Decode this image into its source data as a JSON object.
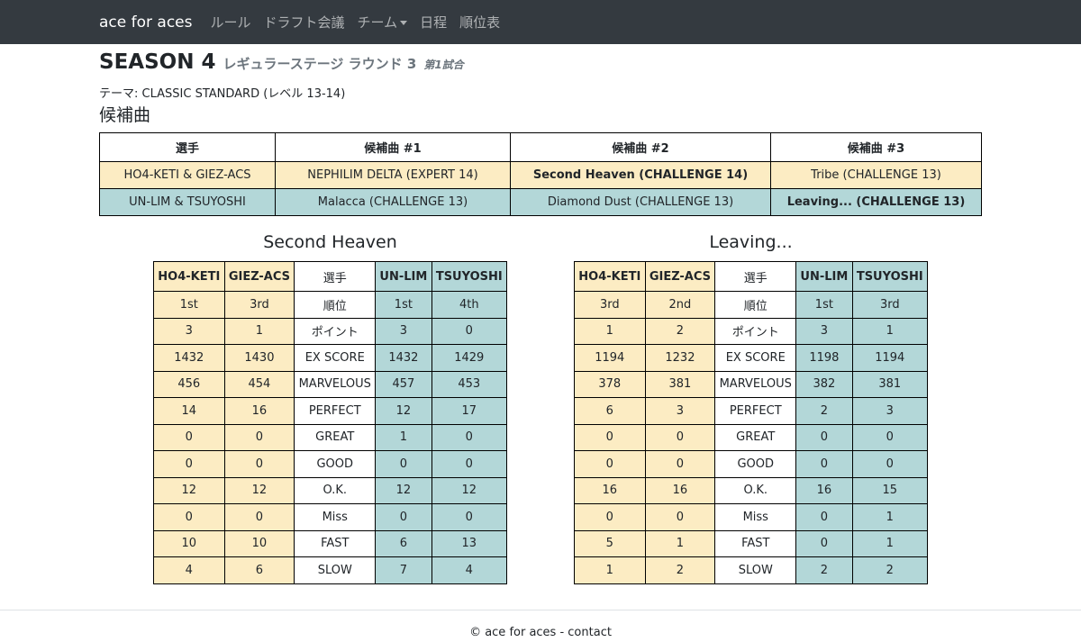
{
  "nav": {
    "brand": "ace for aces",
    "items": [
      "ルール",
      "ドラフト会議",
      "チーム",
      "日程",
      "順位表"
    ]
  },
  "header": {
    "season": "SEASON 4",
    "round": "レギュラーステージ ラウンド 3",
    "game": "第1試合",
    "theme": "テーマ: CLASSIC STANDARD (レベル 13-14)",
    "candidates_heading": "候補曲"
  },
  "candidates": {
    "headers": [
      "選手",
      "候補曲 #1",
      "候補曲 #2",
      "候補曲 #3"
    ],
    "rows": [
      [
        "HO4-KETI & GIEZ-ACS",
        "NEPHILIM DELTA (EXPERT 14)",
        "Second Heaven (CHALLENGE 14)",
        "Tribe (CHALLENGE 13)"
      ],
      [
        "UN-LIM & TSUYOSHI",
        "Malacca (CHALLENGE 13)",
        "Diamond Dust (CHALLENGE 13)",
        "Leaving... (CHALLENGE 13)"
      ]
    ]
  },
  "results": [
    {
      "title": "Second Heaven",
      "headers": [
        "HO4-KETI",
        "GIEZ-ACS",
        "選手",
        "UN-LIM",
        "TSUYOSHI"
      ],
      "rows": [
        [
          "1st",
          "3rd",
          "順位",
          "1st",
          "4th"
        ],
        [
          "3",
          "1",
          "ポイント",
          "3",
          "0"
        ],
        [
          "1432",
          "1430",
          "EX SCORE",
          "1432",
          "1429"
        ],
        [
          "456",
          "454",
          "MARVELOUS",
          "457",
          "453"
        ],
        [
          "14",
          "16",
          "PERFECT",
          "12",
          "17"
        ],
        [
          "0",
          "0",
          "GREAT",
          "1",
          "0"
        ],
        [
          "0",
          "0",
          "GOOD",
          "0",
          "0"
        ],
        [
          "12",
          "12",
          "O.K.",
          "12",
          "12"
        ],
        [
          "0",
          "0",
          "Miss",
          "0",
          "0"
        ],
        [
          "10",
          "10",
          "FAST",
          "6",
          "13"
        ],
        [
          "4",
          "6",
          "SLOW",
          "7",
          "4"
        ]
      ]
    },
    {
      "title": "Leaving...",
      "headers": [
        "HO4-KETI",
        "GIEZ-ACS",
        "選手",
        "UN-LIM",
        "TSUYOSHI"
      ],
      "rows": [
        [
          "3rd",
          "2nd",
          "順位",
          "1st",
          "3rd"
        ],
        [
          "1",
          "2",
          "ポイント",
          "3",
          "1"
        ],
        [
          "1194",
          "1232",
          "EX SCORE",
          "1198",
          "1194"
        ],
        [
          "378",
          "381",
          "MARVELOUS",
          "382",
          "381"
        ],
        [
          "6",
          "3",
          "PERFECT",
          "2",
          "3"
        ],
        [
          "0",
          "0",
          "GREAT",
          "0",
          "0"
        ],
        [
          "0",
          "0",
          "GOOD",
          "0",
          "0"
        ],
        [
          "16",
          "16",
          "O.K.",
          "16",
          "15"
        ],
        [
          "0",
          "0",
          "Miss",
          "0",
          "1"
        ],
        [
          "5",
          "1",
          "FAST",
          "0",
          "1"
        ],
        [
          "1",
          "2",
          "SLOW",
          "2",
          "2"
        ]
      ]
    }
  ],
  "footer": "© ace for aces - contact",
  "colors": {
    "team_a": "#fcecc3",
    "team_b": "#b3d7d8",
    "navbar": "#343a40"
  }
}
